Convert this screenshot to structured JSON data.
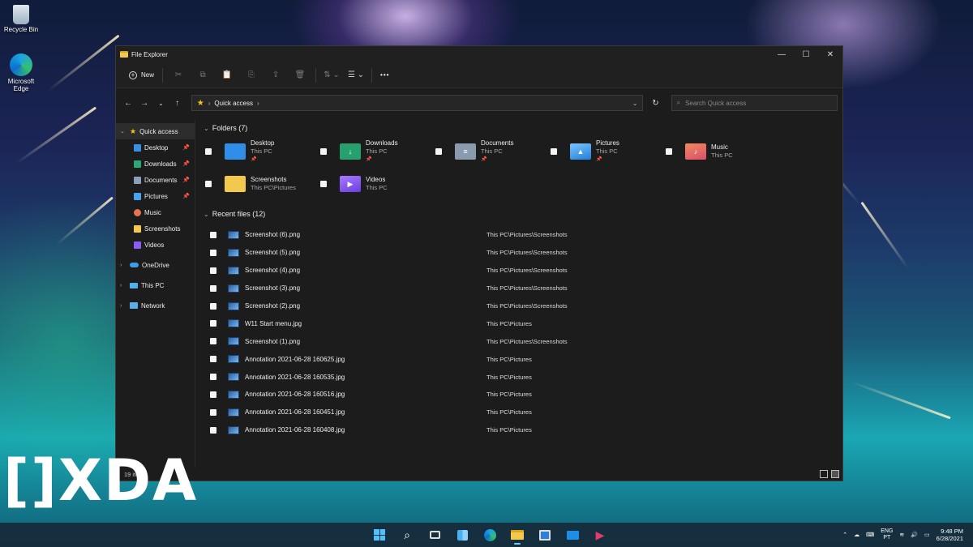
{
  "desktop": {
    "icons": [
      {
        "label": "Recycle Bin",
        "icon": "recycle-bin-icon"
      },
      {
        "label": "Microsoft Edge",
        "icon": "edge-icon"
      }
    ]
  },
  "window": {
    "title": "File Explorer",
    "controls": {
      "minimize": "—",
      "maximize": "☐",
      "close": "✕"
    }
  },
  "toolbar": {
    "new_label": "New",
    "more_label": "•••"
  },
  "address": {
    "crumb": "Quick access",
    "search_placeholder": "Search Quick access"
  },
  "sidebar": {
    "quick_access": "Quick access",
    "quick_items": [
      {
        "label": "Desktop",
        "pinned": true,
        "color": "#3a8ee6"
      },
      {
        "label": "Downloads",
        "pinned": true,
        "color": "#2aa876"
      },
      {
        "label": "Documents",
        "pinned": true,
        "color": "#8aa0b8"
      },
      {
        "label": "Pictures",
        "pinned": true,
        "color": "#4aa3ef"
      },
      {
        "label": "Music",
        "pinned": false,
        "color": "#e8744f"
      },
      {
        "label": "Screenshots",
        "pinned": false,
        "color": "#f2c94c"
      },
      {
        "label": "Videos",
        "pinned": false,
        "color": "#8a5cf5"
      }
    ],
    "onedrive": "OneDrive",
    "this_pc": "This PC",
    "network": "Network"
  },
  "folders": {
    "heading": "Folders (7)",
    "items": [
      {
        "name": "Desktop",
        "location": "This PC",
        "pinned": true,
        "color": "#2f8fe8"
      },
      {
        "name": "Downloads",
        "location": "This PC",
        "pinned": true,
        "color": "#25a06e"
      },
      {
        "name": "Documents",
        "location": "This PC",
        "pinned": true,
        "color": "#8a9bb0"
      },
      {
        "name": "Pictures",
        "location": "This PC",
        "pinned": true,
        "color": "#3c9ef0"
      },
      {
        "name": "Music",
        "location": "This PC",
        "pinned": false,
        "color": "#e86a4a"
      },
      {
        "name": "Screenshots",
        "location": "This PC\\Pictures",
        "pinned": false,
        "color": "#f2c94c"
      },
      {
        "name": "Videos",
        "location": "This PC",
        "pinned": false,
        "color": "#8b5cf6"
      }
    ]
  },
  "recent": {
    "heading": "Recent files (12)",
    "files": [
      {
        "name": "Screenshot (6).png",
        "path": "This PC\\Pictures\\Screenshots"
      },
      {
        "name": "Screenshot (5).png",
        "path": "This PC\\Pictures\\Screenshots"
      },
      {
        "name": "Screenshot (4).png",
        "path": "This PC\\Pictures\\Screenshots"
      },
      {
        "name": "Screenshot (3).png",
        "path": "This PC\\Pictures\\Screenshots"
      },
      {
        "name": "Screenshot (2).png",
        "path": "This PC\\Pictures\\Screenshots"
      },
      {
        "name": "W11 Start menu.jpg",
        "path": "This PC\\Pictures"
      },
      {
        "name": "Screenshot (1).png",
        "path": "This PC\\Pictures\\Screenshots"
      },
      {
        "name": "Annotation 2021-06-28 160625.jpg",
        "path": "This PC\\Pictures"
      },
      {
        "name": "Annotation 2021-06-28 160535.jpg",
        "path": "This PC\\Pictures"
      },
      {
        "name": "Annotation 2021-06-28 160516.jpg",
        "path": "This PC\\Pictures"
      },
      {
        "name": "Annotation 2021-06-28 160451.jpg",
        "path": "This PC\\Pictures"
      },
      {
        "name": "Annotation 2021-06-28 160408.jpg",
        "path": "This PC\\Pictures"
      }
    ]
  },
  "status": {
    "items": "19 items"
  },
  "watermark": "[]XDA",
  "taskbar": {
    "apps": [
      "start-icon",
      "search-icon",
      "task-view-icon",
      "widgets-icon",
      "edge-icon",
      "file-explorer-icon",
      "store-icon",
      "mail-icon",
      "media-player-icon"
    ],
    "active_app": "file-explorer-icon",
    "lang_top": "ENG",
    "lang_bottom": "PT",
    "time": "9:48 PM",
    "date": "6/28/2021"
  }
}
